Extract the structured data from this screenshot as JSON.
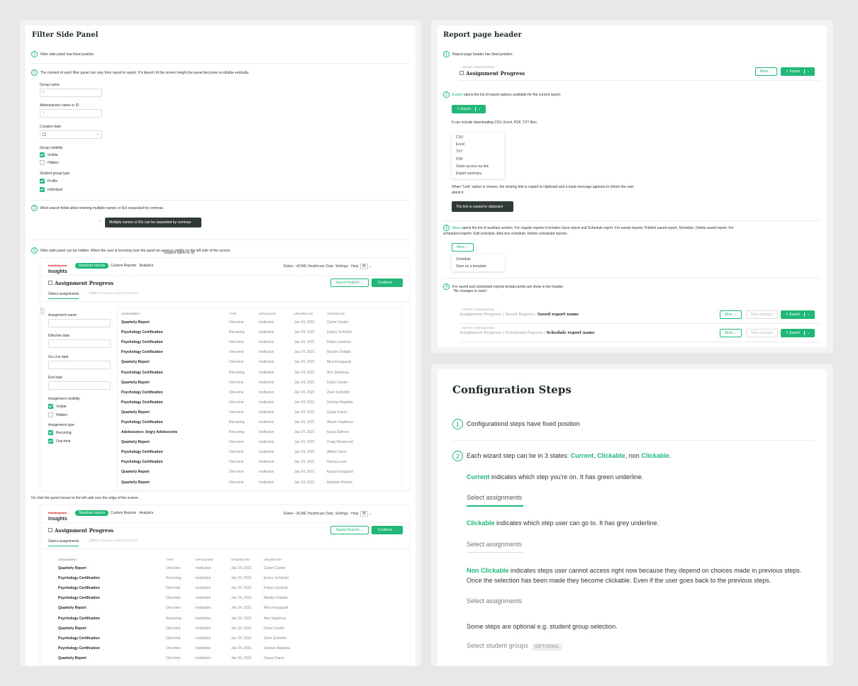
{
  "left": {
    "title": "Filter Side Panel",
    "s1": "Filter side panel has fixed position",
    "s2": "The content of each filter panel can vary from report to report. If it doesn't fit the screen height the panel becomes scrollable vertically.",
    "s3": "Most search fields allow entering multiple names or IDs separated by commas.",
    "s3_ghost": "Student name or ID",
    "tooltip": "Multiple names or IDs can be separated by commas",
    "s4": "Filter side panel can be hidden. When the user is hovering over the panel an arrow is visible on the left side of the screen.",
    "s4b": "On click the panel moves to the left side over the edge of the screen.",
    "filters": {
      "group_name": "Group name",
      "admin": "Administrator name or ID",
      "creation_date": "Creation date",
      "group_visibility": "Group visibility",
      "visible": "Visible",
      "hidden": "Hidden",
      "student_group_type": "Student group type",
      "profile": "Profile",
      "individual": "Individual"
    },
    "app": {
      "logo_top": "HealthSystem",
      "logo": "Insights",
      "tab1": "Standard reports",
      "tab2": "Custom Reports",
      "tab3": "Analytics",
      "org": "Ekken - ACME Healthcare Data",
      "settings": "Settings",
      "help": "Help",
      "avatar": "IB",
      "page_title": "Assignment Progress",
      "saved_reports": "Saved Reports",
      "continue": "Continue",
      "step1": "Select assignments",
      "step_arrow": "→ Select",
      "step2": "Groups and Students",
      "sf": {
        "assignment_name": "Assignment name",
        "effective_date": "Effective date",
        "golive": "Go-Live date",
        "end_date": "End date",
        "assignment_visibility": "Assignment visibility",
        "visible": "Visible",
        "hidden": "Hidden",
        "assignment_type": "Assignment type",
        "recurring": "Recurring",
        "onetime": "One-time"
      },
      "cols": [
        "Assignment",
        "Type",
        "Affiliation",
        "Updated on",
        "Updated by"
      ],
      "rows": [
        [
          "Quarterly Report",
          "One-time",
          "Institution",
          "Jan 24, 2021",
          "Carter Carder"
        ],
        [
          "Psychology Certification",
          "Recurring",
          "Institution",
          "Jan 24, 2021",
          "Emery Schleifer"
        ],
        [
          "Psychology Certification",
          "One-time",
          "Institution",
          "Jan 24, 2021",
          "Paityn Lipshutz"
        ],
        [
          "Psychology Certification",
          "One-time",
          "Institution",
          "Jan 24, 2021",
          "Marilyn Dokidis"
        ],
        [
          "Quarterly Report",
          "One-time",
          "Institution",
          "Jan 24, 2021",
          "Mira Korsgaard"
        ],
        [
          "Psychology Certification",
          "Recurring",
          "Institution",
          "Jan 24, 2021",
          "Ann Septimus"
        ],
        [
          "Quarterly Report",
          "One-time",
          "Institution",
          "Jan 24, 2021",
          "Dulce Carder"
        ],
        [
          "Psychology Certification",
          "One-time",
          "Institution",
          "Jan 24, 2021",
          "Zaire Schleifer"
        ],
        [
          "Psychology Certification",
          "One-time",
          "Institution",
          "Jan 24, 2021",
          "Desirae Baptista"
        ],
        [
          "Quarterly Report",
          "One-time",
          "Institution",
          "Jan 24, 2021",
          "Giana Franci"
        ],
        [
          "Psychology Certification",
          "Recurring",
          "Institution",
          "Jan 24, 2021",
          "Abram Septimus"
        ],
        [
          "Adolescence: Angry Adolescents",
          "Recurring",
          "Institution",
          "Jan 24, 2021",
          "Kaiya Siphron"
        ],
        [
          "Quarterly Report",
          "One-time",
          "Institution",
          "Jan 24, 2021",
          "Craig Westervelt"
        ],
        [
          "Psychology Certification",
          "One-time",
          "Institution",
          "Jan 24, 2021",
          "Allison Saris"
        ],
        [
          "Psychology Certification",
          "One-time",
          "Institution",
          "Jan 24, 2021",
          "Hanna Levin"
        ],
        [
          "Quarterly Report",
          "One-time",
          "Institution",
          "Jan 24, 2021",
          "Kaiya Korsgaard"
        ],
        [
          "Quarterly Report",
          "One-time",
          "Institution",
          "Jan 24, 2021",
          "Madelyn Botosh"
        ]
      ],
      "rows2": [
        [
          "Quarterly Report",
          "One-time",
          "Institution",
          "Jan 24, 2021",
          "Carter Carder"
        ],
        [
          "Psychology Certification",
          "Recurring",
          "Institution",
          "Jan 24, 2021",
          "Emery Schleifer"
        ],
        [
          "Psychology Certification",
          "One-time",
          "Institution",
          "Jan 24, 2021",
          "Paityn Lipshutz"
        ],
        [
          "Psychology Certification",
          "One-time",
          "Institution",
          "Jan 24, 2021",
          "Marilyn Dokidis"
        ],
        [
          "Quarterly Report",
          "One-time",
          "Institution",
          "Jan 24, 2021",
          "Mira Korsgaard"
        ],
        [
          "Psychology Certification",
          "Recurring",
          "Institution",
          "Jan 24, 2021",
          "Ann Septimus"
        ],
        [
          "Quarterly Report",
          "One-time",
          "Institution",
          "Jan 24, 2021",
          "Dulce Carder"
        ],
        [
          "Psychology Certification",
          "One-time",
          "Institution",
          "Jan 24, 2021",
          "Zaire Schleifer"
        ],
        [
          "Psychology Certification",
          "One-time",
          "Institution",
          "Jan 24, 2021",
          "Desirae Baptista"
        ],
        [
          "Quarterly Report",
          "One-time",
          "Institution",
          "Jan 26, 2021",
          "Giana Franci"
        ]
      ]
    }
  },
  "rh": {
    "title": "Report page header",
    "s1": "Report page header has fixed position",
    "breadcrumb": "← REPORT CONFIGURATION",
    "page_title": "Assignment Progress",
    "more": "More",
    "export": "Export",
    "s2_green": "Export",
    "s2": "opens the list of export options available for the current report.",
    "s2b": "It can include downloading CSV, Excel, PDF, TXT files.",
    "export_items": [
      "CSV",
      "Excel",
      "TXT",
      "PDF",
      "Grant access via link",
      "Export summary"
    ],
    "s2c": "When \"Link\" option is chosen, the sharing link is copied to clipboard and  a toast message appears to inform the user about it.",
    "toast": "The link is copied to clipboard",
    "s3_green": "More",
    "s3": "opens the list of auxiliary actions. For regular reports it includes Save report and Schedule report. For saved reports: Publish saved report, Schedule, Delete saved report. For scheduled reports: Edit schedule, Add new schedule, Delete scheduled reports.",
    "more_items": [
      "Schedule",
      "Save as a template"
    ],
    "s4": "For saved and scheduled reports breadcrumbs are show in the header.",
    "s4b": "\"No changes to save\".",
    "saved_crumb": "Assignment Progress / Saved Reports /",
    "saved_name": "Saved report name",
    "sched_crumb": "Assignment Progress / Scheduled Reports /",
    "sched_name": "Schedule report name",
    "save_changes": "Save changes"
  },
  "cs": {
    "title": "Configuration Steps",
    "s1": "Configurationd steps have fixed position",
    "s2a": "Each wizard step can be in 3 states:",
    "current": "Current",
    "clickable": "Clickable",
    "non": "non",
    "nonclickable": "Clickable",
    "cur_desc": "indicates which step you're on. It has green underline.",
    "click_desc": "indicates which step user can go to. It has grey underline.",
    "non_label": "Non Clickable",
    "non_desc": "indicates steps user cannot access right now because they depend on choices made in previous steps. Once the selection has been made they become clickable. Even if the user goes back to the previous steps.",
    "step": "Select assignments",
    "optional_text": "Some steps are optional e.g. student group selection.",
    "step_groups": "Select student groups",
    "optional": "OPTIONAL"
  }
}
